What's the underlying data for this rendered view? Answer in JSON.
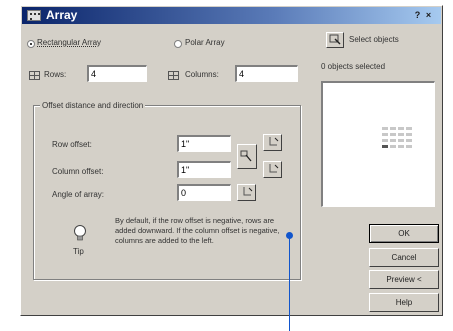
{
  "window": {
    "title": "Array",
    "help_glyph": "?",
    "close_glyph": "×"
  },
  "options": {
    "rectangular": "Rectangular Array",
    "polar": "Polar Array"
  },
  "select_objects": {
    "label": "Select objects",
    "status": "0 objects selected"
  },
  "grid": {
    "rows_label": "Rows:",
    "rows_value": "4",
    "columns_label": "Columns:",
    "columns_value": "4"
  },
  "offset": {
    "group_title": "Offset distance and direction",
    "row_offset_label": "Row offset:",
    "row_offset_value": "1\"",
    "column_offset_label": "Column offset:",
    "column_offset_value": "1\"",
    "angle_label": "Angle of array:",
    "angle_value": "0"
  },
  "tip": {
    "label": "Tip",
    "text": "By default, if the row offset is negative, rows are added downward. If the column offset is negative, columns are added to the left."
  },
  "buttons": {
    "ok": "OK",
    "cancel": "Cancel",
    "preview": "Preview <",
    "help": "Help"
  }
}
